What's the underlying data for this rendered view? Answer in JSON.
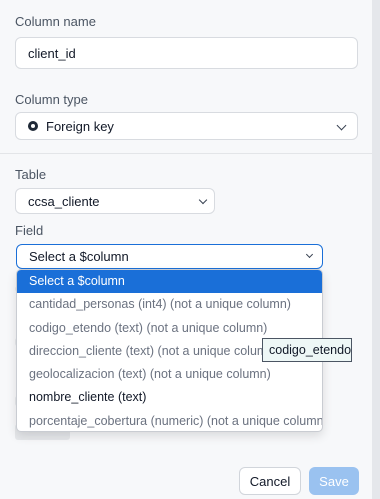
{
  "column_name": {
    "label": "Column name",
    "value": "client_id"
  },
  "column_type": {
    "label": "Column type",
    "value": "Foreign key",
    "icon": "foreign-key-icon"
  },
  "table": {
    "label": "Table",
    "value": "ccsa_cliente"
  },
  "field": {
    "label": "Field",
    "value": "Select a $column",
    "accent": "#1a6fd8",
    "options": [
      {
        "text": "Select a $column",
        "selected": true,
        "unique": true
      },
      {
        "text": "cantidad_personas (int4) (not a unique column)",
        "selected": false,
        "unique": false
      },
      {
        "text": "codigo_etendo (text) (not a unique column)",
        "selected": false,
        "unique": false
      },
      {
        "text": "direccion_cliente (text) (not a unique column)",
        "selected": false,
        "unique": false
      },
      {
        "text": "geolocalizacion (text) (not a unique column)",
        "selected": false,
        "unique": false
      },
      {
        "text": "nombre_cliente (text)",
        "selected": false,
        "unique": true
      },
      {
        "text": "porcentaje_cobertura (numeric) (not a unique column)",
        "selected": false,
        "unique": false
      }
    ]
  },
  "tooltip": {
    "text": "codigo_etendo"
  },
  "footer": {
    "cancel_label": "Cancel",
    "save_label": "Save",
    "save_color": "#9ac2f0"
  }
}
